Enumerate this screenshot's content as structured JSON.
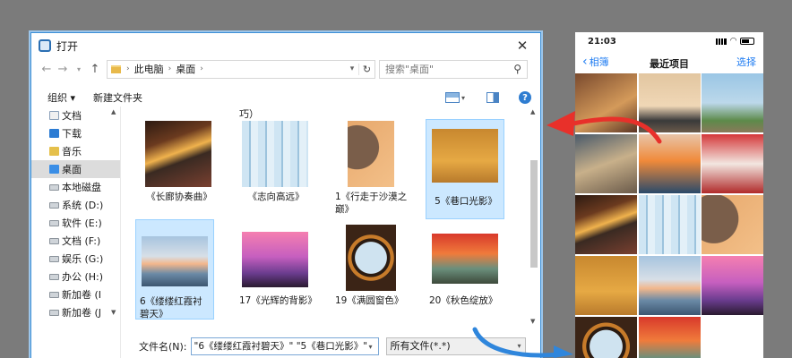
{
  "dialog": {
    "title": "打开",
    "breadcrumb": [
      "此电脑",
      "桌面"
    ],
    "search_placeholder": "搜索\"桌面\"",
    "toolbar": {
      "organize": "组织 ▾",
      "new_folder": "新建文件夹"
    },
    "nav_items": [
      "文档",
      "下载",
      "音乐",
      "桌面",
      "本地磁盘",
      "系统 (D:)",
      "软件 (E:)",
      "文档 (F:)",
      "娱乐 (G:)",
      "办公 (H:)",
      "新加卷 (I",
      "新加卷 (J"
    ],
    "partial_label": "巧）",
    "files": [
      {
        "name": "《长廊协奏曲》",
        "selected": false
      },
      {
        "name": "《志向高远》",
        "selected": false
      },
      {
        "name": "1《行走于沙漠之巅》",
        "selected": false
      },
      {
        "name": "5《巷口光影》",
        "selected": true
      },
      {
        "name": "6《缕缕红霞衬碧天》",
        "selected": true
      },
      {
        "name": "17《光辉的背影》",
        "selected": false
      },
      {
        "name": "19《满圆窗色》",
        "selected": false
      },
      {
        "name": "20《秋色绽放》",
        "selected": false
      }
    ],
    "filename_label": "文件名(N):",
    "filename_value": "\"6《缕缕红霞衬碧天》\" \"5《巷口光影》\"",
    "filetype_value": "所有文件(*.*)"
  },
  "phone": {
    "time": "21:03",
    "back_label": "相簿",
    "title": "最近项目",
    "select_label": "选择"
  },
  "colors": {
    "accent": "#1f7cf2",
    "arrow_red": "#e8302a",
    "arrow_blue": "#2f86dc",
    "selection": "#cce8ff"
  }
}
